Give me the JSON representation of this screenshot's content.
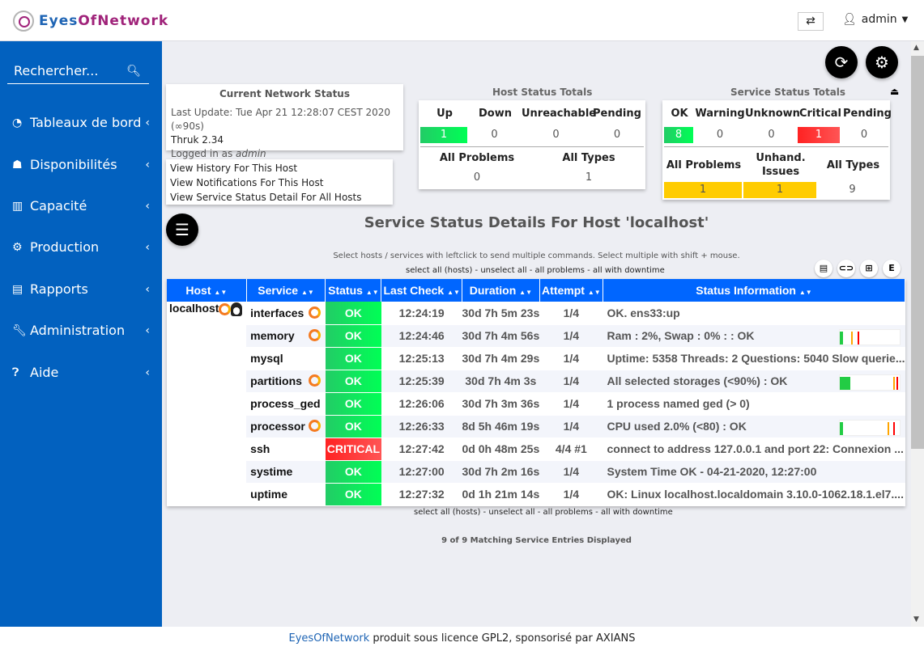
{
  "header": {
    "logo_a": "Eyes",
    "logo_b": "OfNetwork",
    "user": "admin"
  },
  "sidebar": {
    "search_placeholder": "Rechercher...",
    "items": [
      {
        "label": "Tableaux de bord",
        "icon": "dashboard-icon"
      },
      {
        "label": "Disponibilités",
        "icon": "sitemap-icon"
      },
      {
        "label": "Capacité",
        "icon": "bar-chart-icon"
      },
      {
        "label": "Production",
        "icon": "gears-icon"
      },
      {
        "label": "Rapports",
        "icon": "file-icon"
      },
      {
        "label": "Administration",
        "icon": "wrench-icon"
      },
      {
        "label": "Aide",
        "icon": "question-icon"
      }
    ]
  },
  "network_status": {
    "title": "Current Network Status",
    "last_update": "Last Update: Tue Apr 21 12:28:07 CEST 2020 (∞90s)",
    "version": "Thruk 2.34",
    "logged_prefix": "Logged in as ",
    "logged_user": "admin"
  },
  "links": [
    "View History For This Host",
    "View Notifications For This Host",
    "View Service Status Detail For All Hosts"
  ],
  "host_totals": {
    "title": "Host Status Totals",
    "headers": [
      "Up",
      "Down",
      "Unreachable",
      "Pending"
    ],
    "values": [
      "1",
      "0",
      "0",
      "0"
    ],
    "bottom_headers": [
      "All Problems",
      "All Types"
    ],
    "bottom_values": [
      "0",
      "1"
    ]
  },
  "service_totals": {
    "title": "Service Status Totals",
    "headers": [
      "OK",
      "Warning",
      "Unknown",
      "Critical",
      "Pending"
    ],
    "values": [
      "8",
      "0",
      "0",
      "1",
      "0"
    ],
    "bottom_headers": [
      "All Problems",
      "Unhand. Issues",
      "All Types"
    ],
    "bottom_values": [
      "1",
      "1",
      "9"
    ]
  },
  "heading": "Service Status Details For Host 'localhost'",
  "hint": "Select hosts / services with leftclick to send multiple commands. Select multiple with shift + mouse.",
  "select_links": "select all (hosts) - unselect all - all problems - all with downtime",
  "table": {
    "columns": [
      "Host",
      "Service",
      "Status",
      "Last Check",
      "Duration",
      "Attempt",
      "Status Information"
    ],
    "host": "localhost",
    "rows": [
      {
        "service": "interfaces",
        "grafana": true,
        "status": "OK",
        "last_check": "12:24:19",
        "duration": "30d 7h 5m 23s",
        "attempt": "1/4",
        "info": "OK. ens33:up",
        "perf": null
      },
      {
        "service": "memory",
        "grafana": true,
        "status": "OK",
        "last_check": "12:24:46",
        "duration": "30d 7h 4m 56s",
        "attempt": "1/4",
        "info": "Ram : 2%, Swap : 0% : : OK",
        "perf": {
          "value": 0.02,
          "warn": 0.2,
          "crit": 0.3
        }
      },
      {
        "service": "mysql",
        "grafana": false,
        "status": "OK",
        "last_check": "12:25:13",
        "duration": "30d 7h 4m 29s",
        "attempt": "1/4",
        "info": "Uptime: 5358 Threads: 2 Questions: 5040 Slow querie...",
        "perf": null
      },
      {
        "service": "partitions",
        "grafana": true,
        "status": "OK",
        "last_check": "12:25:39",
        "duration": "30d 7h 4m 3s",
        "attempt": "1/4",
        "info": "All selected storages (<90%) : OK",
        "perf": {
          "value": 0.18,
          "warn": 0.9,
          "crit": 0.95
        }
      },
      {
        "service": "process_ged",
        "grafana": false,
        "status": "OK",
        "last_check": "12:26:06",
        "duration": "30d 7h 3m 36s",
        "attempt": "1/4",
        "info": "1 process named ged (> 0)",
        "perf": null
      },
      {
        "service": "processor",
        "grafana": true,
        "status": "OK",
        "last_check": "12:26:33",
        "duration": "8d 5h 46m 19s",
        "attempt": "1/4",
        "info": "CPU used 2.0% (<80) : OK",
        "perf": {
          "value": 0.02,
          "warn": 0.8,
          "crit": 0.9
        }
      },
      {
        "service": "ssh",
        "grafana": false,
        "status": "CRITICAL",
        "last_check": "12:27:42",
        "duration": "0d 0h 48m 25s",
        "attempt": "4/4 #1",
        "info": "connect to address 127.0.0.1 and port 22: Connexion ...",
        "perf": null
      },
      {
        "service": "systime",
        "grafana": false,
        "status": "OK",
        "last_check": "12:27:00",
        "duration": "30d 7h 2m 16s",
        "attempt": "1/4",
        "info": "System Time OK - 04-21-2020, 12:27:00",
        "perf": null
      },
      {
        "service": "uptime",
        "grafana": false,
        "status": "OK",
        "last_check": "12:27:32",
        "duration": "0d 1h 21m 14s",
        "attempt": "1/4",
        "info": "OK: Linux localhost.localdomain 3.10.0-1062.18.1.el7....",
        "perf": null
      }
    ]
  },
  "matching": "9 of 9 Matching Service Entries Displayed",
  "footer": {
    "brand": "EyesOfNetwork",
    "text": " produit sous licence GPL2, sponsorisé par AXIANS"
  },
  "colors": {
    "sidebar": "#0261bf",
    "table_header": "#0066ff",
    "ok": "#00ff55",
    "critical": "#ff2222",
    "problem": "#ffcc00"
  }
}
